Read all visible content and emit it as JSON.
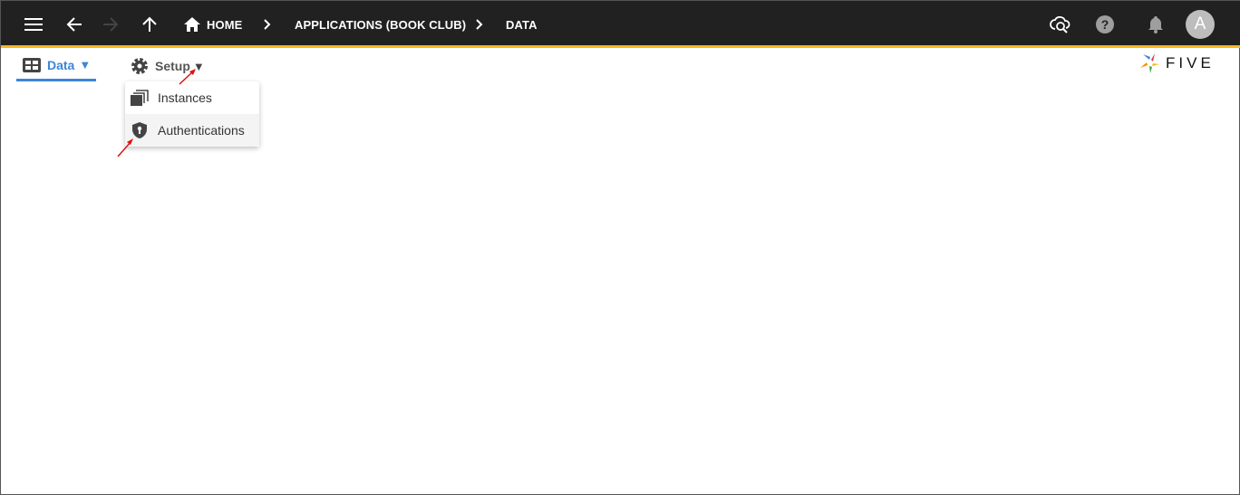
{
  "topbar": {
    "breadcrumbs": [
      {
        "label": "HOME"
      },
      {
        "label": "APPLICATIONS (BOOK CLUB)"
      },
      {
        "label": "DATA"
      }
    ],
    "avatar_letter": "A",
    "icons": [
      "menu-icon",
      "back-arrow-icon",
      "forward-arrow-icon",
      "up-arrow-icon",
      "home-icon",
      "cloud-search-icon",
      "help-icon",
      "bell-icon"
    ]
  },
  "tabs": [
    {
      "label": "Data",
      "arrow": "▼",
      "active": true
    },
    {
      "label": "Setup",
      "arrow": "▼",
      "active": false
    }
  ],
  "setup_menu": {
    "items": [
      {
        "label": "Instances",
        "icon": "instances-icon"
      },
      {
        "label": "Authentications",
        "icon": "shield-icon",
        "highlighted": true
      }
    ]
  },
  "logo": {
    "text": "FIVE"
  },
  "colors": {
    "topbar": "#212121",
    "accent_bar": "#f9b71a",
    "active_tab": "#3d85d8",
    "annotation_arrow": "#e01010"
  }
}
